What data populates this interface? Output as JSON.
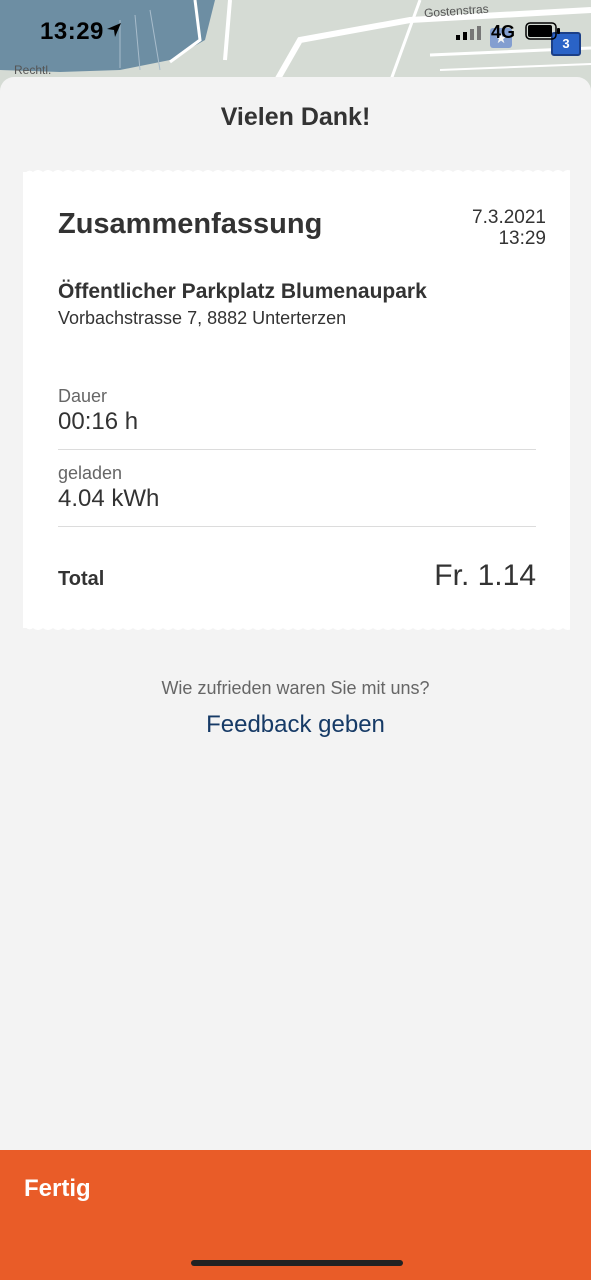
{
  "status_bar": {
    "time": "13:29",
    "network": "4G",
    "map_badge": "3",
    "map_label_left": "Rechtl.",
    "map_label_right": "Gostenstras"
  },
  "sheet": {
    "title": "Vielen Dank!"
  },
  "receipt": {
    "title": "Zusammenfassung",
    "date": "7.3.2021",
    "time": "13:29",
    "place_name": "Öffentlicher Parkplatz Blumenaupark",
    "address": "Vorbachstrasse 7, 8882 Unterterzen",
    "rows": [
      {
        "label": "Dauer",
        "value": "00:16 h"
      },
      {
        "label": "geladen",
        "value": "4.04 kWh"
      }
    ],
    "total_label": "Total",
    "total_value": "Fr. 1.14"
  },
  "feedback": {
    "question": "Wie zufrieden waren Sie mit uns?",
    "link_label": "Feedback geben"
  },
  "footer": {
    "done_label": "Fertig"
  },
  "colors": {
    "accent": "#e95c28",
    "link": "#163a66",
    "background": "#f3f3f3"
  }
}
